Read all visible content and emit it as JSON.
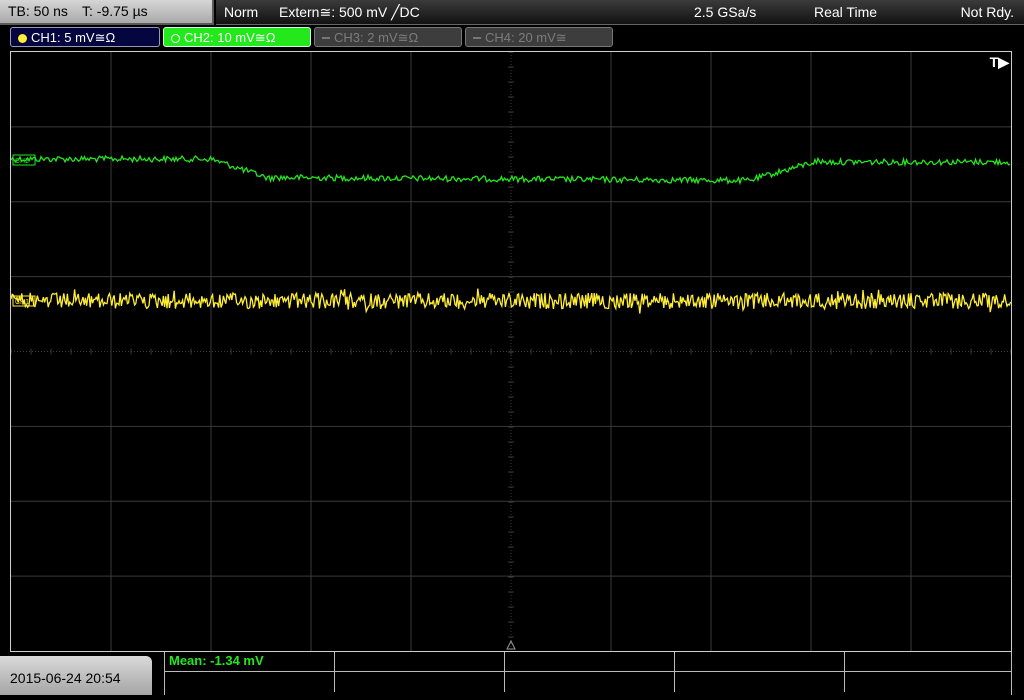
{
  "status_bar": {
    "timebase": "TB: 50 ns",
    "trigger_time": "T: -9.75 µs",
    "trigger_mode": "Norm",
    "trigger_source": "Extern≅: 500 mV ╱DC",
    "sample_rate": "2.5 GSa/s",
    "acquisition_mode": "Real Time",
    "acquisition_status": "Not Rdy."
  },
  "channels": [
    {
      "label": "CH1: 5 mV≅Ω",
      "state": "on",
      "color": "#ffee33"
    },
    {
      "label": "CH2: 10 mV≅Ω",
      "state": "selected",
      "color": "#22e81c"
    },
    {
      "label": "CH3: 2 mV≅Ω",
      "state": "off",
      "color": "#7c7c7c"
    },
    {
      "label": "CH4: 20 mV≅",
      "state": "off",
      "color": "#7c7c7c"
    }
  ],
  "screen": {
    "trigger_position_marker": "T▶",
    "ch1_marker": "CH1",
    "ch2_marker": "CH2",
    "trace_colors": {
      "ch1": "#ffee33",
      "ch2": "#22e81c",
      "grid": "#3a3a3a"
    }
  },
  "footer": {
    "datetime": "2015-06-24 20:54",
    "measurement": "Mean: -1.34 mV"
  }
}
